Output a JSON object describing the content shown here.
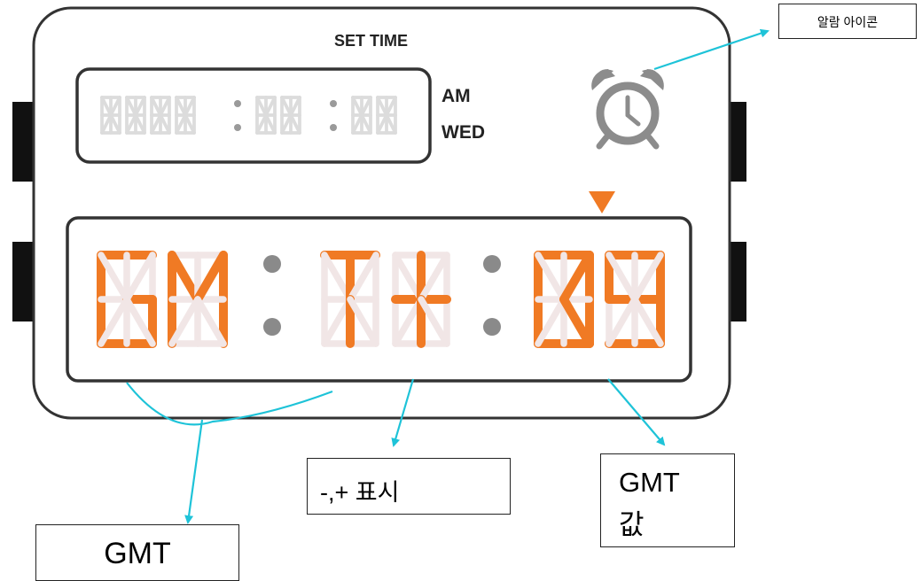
{
  "device": {
    "header": "SET TIME",
    "ampm": "AM",
    "weekday": "WED",
    "small_display": {
      "pattern": [
        "#",
        "#",
        "#",
        "#",
        ":",
        "#",
        "#",
        ":",
        "#",
        "#"
      ]
    },
    "big_display": {
      "chars": [
        "G",
        "M",
        ":",
        "T",
        "+",
        ":",
        "0",
        "9"
      ],
      "active_color": "#f07a24",
      "inactive_color": "#f1e6e6",
      "dot_color": "#8a8a8a"
    },
    "alarm_icon": "alarm-clock-icon",
    "pointer_icon": "down-triangle-icon",
    "pointer_color": "#f07a24"
  },
  "callouts": {
    "alarm": "알람 아이콘",
    "sign": "-,+ 표시",
    "gmt_value_line1": "GMT",
    "gmt_value_line2": "값",
    "gmt": "GMT",
    "arrow_color": "#1ec3d8"
  }
}
